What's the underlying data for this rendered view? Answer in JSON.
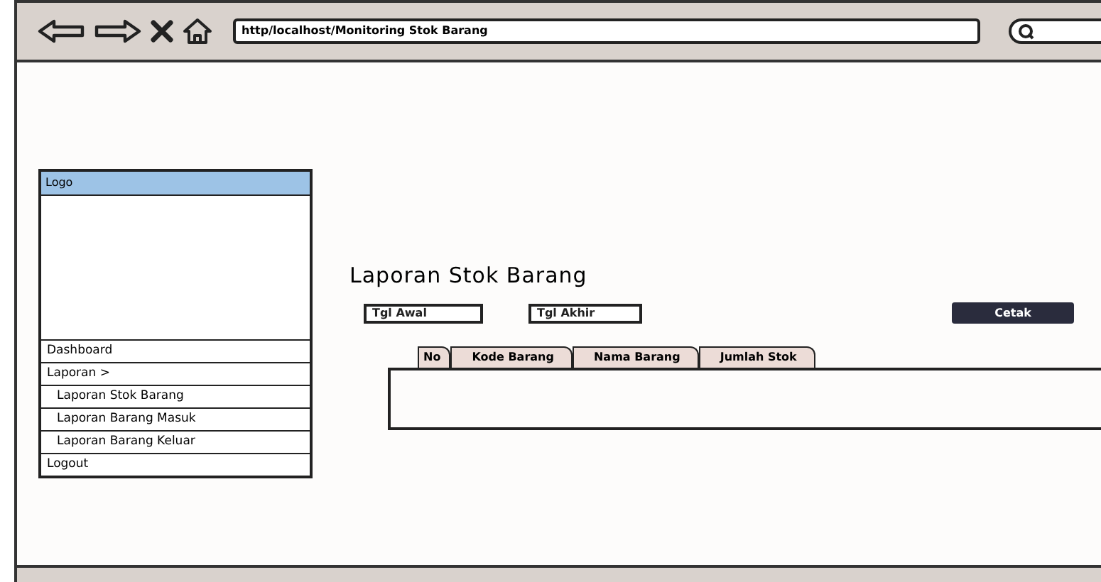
{
  "browser": {
    "url": "http/localhost/Monitoring Stok Barang"
  },
  "sidebar": {
    "logo": "Logo",
    "items": [
      {
        "label": "Dashboard",
        "kind": "main"
      },
      {
        "label": "Laporan >",
        "kind": "main"
      },
      {
        "label": "Laporan Stok Barang",
        "kind": "sub"
      },
      {
        "label": "Laporan Barang Masuk",
        "kind": "sub"
      },
      {
        "label": "Laporan Barang Keluar",
        "kind": "sub"
      },
      {
        "label": "Logout",
        "kind": "main"
      }
    ]
  },
  "page_title": "Laporan Stok Barang",
  "filters": [
    {
      "placeholder": "Tgl Awal"
    },
    {
      "placeholder": "Tgl Akhir"
    }
  ],
  "print_button": "Cetak",
  "table": {
    "columns": [
      "No",
      "Kode Barang",
      "Nama Barang",
      "Jumlah Stok"
    ]
  }
}
